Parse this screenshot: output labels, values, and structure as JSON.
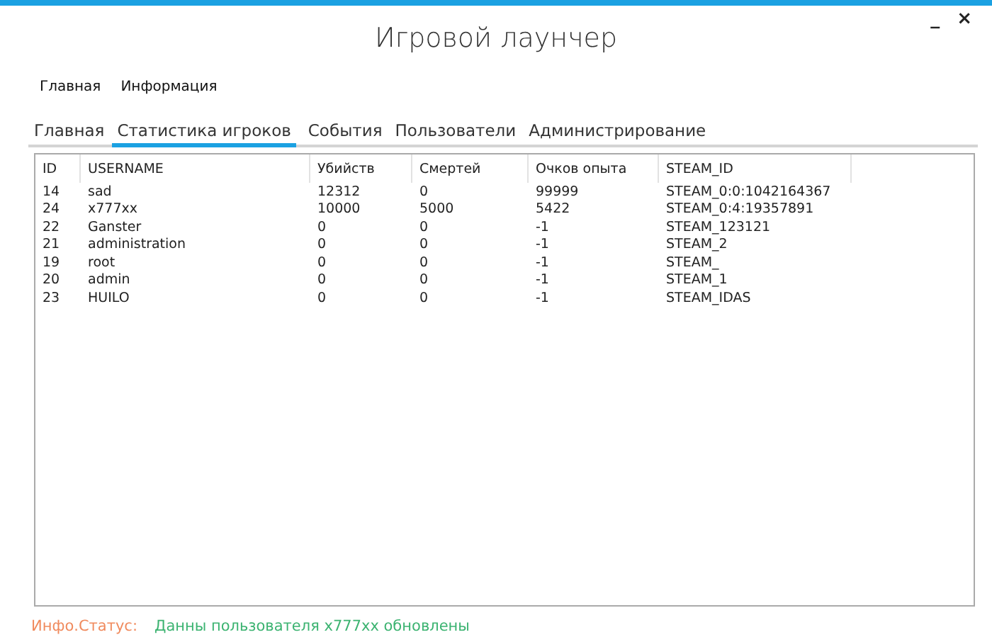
{
  "window": {
    "title": "Игровой лаунчер",
    "controls": [
      "_",
      "×"
    ]
  },
  "menu": [
    "Главная",
    "Информация"
  ],
  "tabs": [
    {
      "label": "Главная",
      "selected": false
    },
    {
      "label": "Статистика игроков",
      "selected": true
    },
    {
      "label": "События",
      "selected": false
    },
    {
      "label": "Пользователи",
      "selected": false
    },
    {
      "label": "Администрирование",
      "selected": false
    }
  ],
  "table": {
    "columns": [
      "ID",
      "USERNAME",
      "Убийств",
      "Смертей",
      "Очков опыта",
      "STEAM_ID"
    ],
    "rows": [
      [
        "14",
        "sad",
        "12312",
        "0",
        "99999",
        "STEAM_0:0:1042164367"
      ],
      [
        "24",
        "x777xx",
        "10000",
        "5000",
        "5422",
        "STEAM_0:4:19357891"
      ],
      [
        "22",
        "Ganster",
        "0",
        "0",
        "-1",
        "STEAM_123121"
      ],
      [
        "21",
        "administration",
        "0",
        "0",
        "-1",
        "STEAM_2"
      ],
      [
        "19",
        "root",
        "0",
        "0",
        "-1",
        "STEAM_"
      ],
      [
        "20",
        "admin",
        "0",
        "0",
        "-1",
        "STEAM_1"
      ],
      [
        "23",
        "HUILO",
        "0",
        "0",
        "-1",
        "STEAM_IDAS"
      ]
    ]
  },
  "status_bar": {
    "label": "Инфо.Статус:",
    "message": "Данны пользователя x777xx обновлены"
  }
}
